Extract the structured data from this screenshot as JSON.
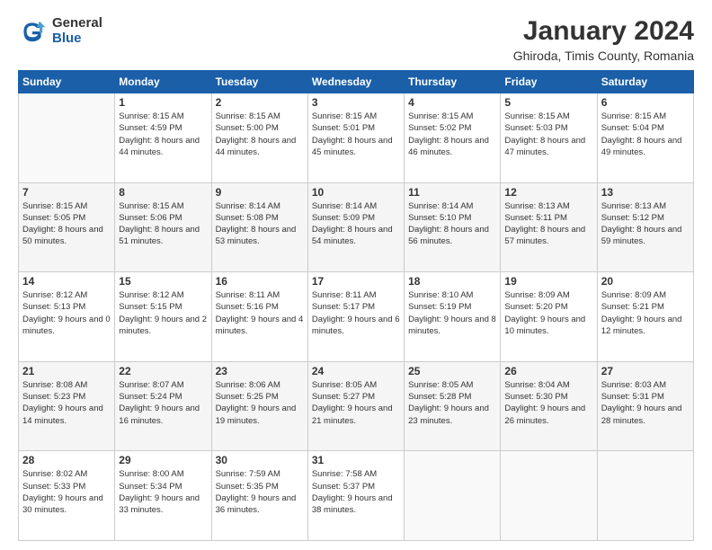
{
  "logo": {
    "general": "General",
    "blue": "Blue"
  },
  "title": "January 2024",
  "subtitle": "Ghiroda, Timis County, Romania",
  "days": [
    "Sunday",
    "Monday",
    "Tuesday",
    "Wednesday",
    "Thursday",
    "Friday",
    "Saturday"
  ],
  "weeks": [
    [
      {
        "num": "",
        "sunrise": "",
        "sunset": "",
        "daylight": "",
        "empty": true
      },
      {
        "num": "1",
        "sunrise": "Sunrise: 8:15 AM",
        "sunset": "Sunset: 4:59 PM",
        "daylight": "Daylight: 8 hours and 44 minutes."
      },
      {
        "num": "2",
        "sunrise": "Sunrise: 8:15 AM",
        "sunset": "Sunset: 5:00 PM",
        "daylight": "Daylight: 8 hours and 44 minutes."
      },
      {
        "num": "3",
        "sunrise": "Sunrise: 8:15 AM",
        "sunset": "Sunset: 5:01 PM",
        "daylight": "Daylight: 8 hours and 45 minutes."
      },
      {
        "num": "4",
        "sunrise": "Sunrise: 8:15 AM",
        "sunset": "Sunset: 5:02 PM",
        "daylight": "Daylight: 8 hours and 46 minutes."
      },
      {
        "num": "5",
        "sunrise": "Sunrise: 8:15 AM",
        "sunset": "Sunset: 5:03 PM",
        "daylight": "Daylight: 8 hours and 47 minutes."
      },
      {
        "num": "6",
        "sunrise": "Sunrise: 8:15 AM",
        "sunset": "Sunset: 5:04 PM",
        "daylight": "Daylight: 8 hours and 49 minutes."
      }
    ],
    [
      {
        "num": "7",
        "sunrise": "Sunrise: 8:15 AM",
        "sunset": "Sunset: 5:05 PM",
        "daylight": "Daylight: 8 hours and 50 minutes."
      },
      {
        "num": "8",
        "sunrise": "Sunrise: 8:15 AM",
        "sunset": "Sunset: 5:06 PM",
        "daylight": "Daylight: 8 hours and 51 minutes."
      },
      {
        "num": "9",
        "sunrise": "Sunrise: 8:14 AM",
        "sunset": "Sunset: 5:08 PM",
        "daylight": "Daylight: 8 hours and 53 minutes."
      },
      {
        "num": "10",
        "sunrise": "Sunrise: 8:14 AM",
        "sunset": "Sunset: 5:09 PM",
        "daylight": "Daylight: 8 hours and 54 minutes."
      },
      {
        "num": "11",
        "sunrise": "Sunrise: 8:14 AM",
        "sunset": "Sunset: 5:10 PM",
        "daylight": "Daylight: 8 hours and 56 minutes."
      },
      {
        "num": "12",
        "sunrise": "Sunrise: 8:13 AM",
        "sunset": "Sunset: 5:11 PM",
        "daylight": "Daylight: 8 hours and 57 minutes."
      },
      {
        "num": "13",
        "sunrise": "Sunrise: 8:13 AM",
        "sunset": "Sunset: 5:12 PM",
        "daylight": "Daylight: 8 hours and 59 minutes."
      }
    ],
    [
      {
        "num": "14",
        "sunrise": "Sunrise: 8:12 AM",
        "sunset": "Sunset: 5:13 PM",
        "daylight": "Daylight: 9 hours and 0 minutes."
      },
      {
        "num": "15",
        "sunrise": "Sunrise: 8:12 AM",
        "sunset": "Sunset: 5:15 PM",
        "daylight": "Daylight: 9 hours and 2 minutes."
      },
      {
        "num": "16",
        "sunrise": "Sunrise: 8:11 AM",
        "sunset": "Sunset: 5:16 PM",
        "daylight": "Daylight: 9 hours and 4 minutes."
      },
      {
        "num": "17",
        "sunrise": "Sunrise: 8:11 AM",
        "sunset": "Sunset: 5:17 PM",
        "daylight": "Daylight: 9 hours and 6 minutes."
      },
      {
        "num": "18",
        "sunrise": "Sunrise: 8:10 AM",
        "sunset": "Sunset: 5:19 PM",
        "daylight": "Daylight: 9 hours and 8 minutes."
      },
      {
        "num": "19",
        "sunrise": "Sunrise: 8:09 AM",
        "sunset": "Sunset: 5:20 PM",
        "daylight": "Daylight: 9 hours and 10 minutes."
      },
      {
        "num": "20",
        "sunrise": "Sunrise: 8:09 AM",
        "sunset": "Sunset: 5:21 PM",
        "daylight": "Daylight: 9 hours and 12 minutes."
      }
    ],
    [
      {
        "num": "21",
        "sunrise": "Sunrise: 8:08 AM",
        "sunset": "Sunset: 5:23 PM",
        "daylight": "Daylight: 9 hours and 14 minutes."
      },
      {
        "num": "22",
        "sunrise": "Sunrise: 8:07 AM",
        "sunset": "Sunset: 5:24 PM",
        "daylight": "Daylight: 9 hours and 16 minutes."
      },
      {
        "num": "23",
        "sunrise": "Sunrise: 8:06 AM",
        "sunset": "Sunset: 5:25 PM",
        "daylight": "Daylight: 9 hours and 19 minutes."
      },
      {
        "num": "24",
        "sunrise": "Sunrise: 8:05 AM",
        "sunset": "Sunset: 5:27 PM",
        "daylight": "Daylight: 9 hours and 21 minutes."
      },
      {
        "num": "25",
        "sunrise": "Sunrise: 8:05 AM",
        "sunset": "Sunset: 5:28 PM",
        "daylight": "Daylight: 9 hours and 23 minutes."
      },
      {
        "num": "26",
        "sunrise": "Sunrise: 8:04 AM",
        "sunset": "Sunset: 5:30 PM",
        "daylight": "Daylight: 9 hours and 26 minutes."
      },
      {
        "num": "27",
        "sunrise": "Sunrise: 8:03 AM",
        "sunset": "Sunset: 5:31 PM",
        "daylight": "Daylight: 9 hours and 28 minutes."
      }
    ],
    [
      {
        "num": "28",
        "sunrise": "Sunrise: 8:02 AM",
        "sunset": "Sunset: 5:33 PM",
        "daylight": "Daylight: 9 hours and 30 minutes."
      },
      {
        "num": "29",
        "sunrise": "Sunrise: 8:00 AM",
        "sunset": "Sunset: 5:34 PM",
        "daylight": "Daylight: 9 hours and 33 minutes."
      },
      {
        "num": "30",
        "sunrise": "Sunrise: 7:59 AM",
        "sunset": "Sunset: 5:35 PM",
        "daylight": "Daylight: 9 hours and 36 minutes."
      },
      {
        "num": "31",
        "sunrise": "Sunrise: 7:58 AM",
        "sunset": "Sunset: 5:37 PM",
        "daylight": "Daylight: 9 hours and 38 minutes."
      },
      {
        "num": "",
        "sunrise": "",
        "sunset": "",
        "daylight": "",
        "empty": true
      },
      {
        "num": "",
        "sunrise": "",
        "sunset": "",
        "daylight": "",
        "empty": true
      },
      {
        "num": "",
        "sunrise": "",
        "sunset": "",
        "daylight": "",
        "empty": true
      }
    ]
  ]
}
